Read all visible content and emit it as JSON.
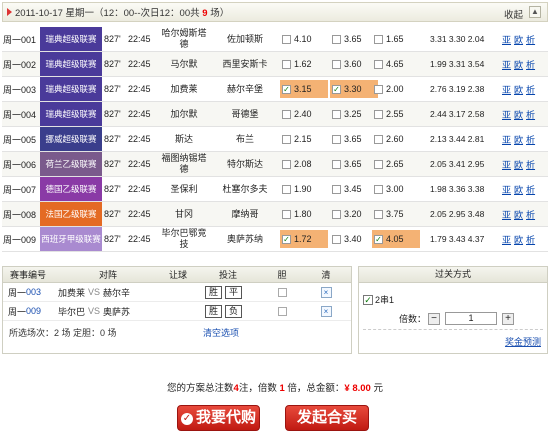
{
  "header": {
    "title_prefix": "2011-10-17 星期一（12：00--次日12：00共 ",
    "count": "9",
    "title_suffix": " 场）",
    "collapse": "收起",
    "up_icon": "▲"
  },
  "matches": [
    {
      "id": "周一001",
      "league": "瑞典超级联赛",
      "color": "#4a3a9a",
      "round": "827'",
      "time": "22:45",
      "home": "哈尔姆斯塔德",
      "away": "佐加顿斯",
      "odds": [
        "4.10",
        "3.65",
        "1.65"
      ],
      "sel": [
        false,
        false,
        false
      ],
      "avg": "3.31 3.30 2.04",
      "links": [
        "亚",
        "欧",
        "析"
      ]
    },
    {
      "id": "周一002",
      "league": "瑞典超级联赛",
      "color": "#4a3a9a",
      "round": "827'",
      "time": "22:45",
      "home": "马尔默",
      "away": "西里安斯卡",
      "odds": [
        "1.62",
        "3.60",
        "4.65"
      ],
      "sel": [
        false,
        false,
        false
      ],
      "avg": "1.99 3.31 3.54",
      "links": [
        "亚",
        "欧",
        "析"
      ]
    },
    {
      "id": "周一003",
      "league": "瑞典超级联赛",
      "color": "#4a3a9a",
      "round": "827'",
      "time": "22:45",
      "home": "加费莱",
      "away": "赫尔辛堡",
      "odds": [
        "3.15",
        "3.30",
        "2.00"
      ],
      "sel": [
        true,
        true,
        false
      ],
      "avg": "2.76 3.19 2.38",
      "links": [
        "亚",
        "欧",
        "析"
      ]
    },
    {
      "id": "周一004",
      "league": "瑞典超级联赛",
      "color": "#4a3a9a",
      "round": "827'",
      "time": "22:45",
      "home": "加尔默",
      "away": "哥德堡",
      "odds": [
        "2.40",
        "3.25",
        "2.55"
      ],
      "sel": [
        false,
        false,
        false
      ],
      "avg": "2.44 3.17 2.58",
      "links": [
        "亚",
        "欧",
        "析"
      ]
    },
    {
      "id": "周一005",
      "league": "挪威超级联赛",
      "color": "#3a3e8c",
      "round": "827'",
      "time": "22:45",
      "home": "斯达",
      "away": "布兰",
      "odds": [
        "2.15",
        "3.65",
        "2.60"
      ],
      "sel": [
        false,
        false,
        false
      ],
      "avg": "2.13 3.44 2.81",
      "links": [
        "亚",
        "欧",
        "析"
      ]
    },
    {
      "id": "周一006",
      "league": "荷兰乙级联赛",
      "color": "#7a5a8c",
      "round": "827'",
      "time": "22:45",
      "home": "福图纳锡塔德",
      "away": "特尔斯达",
      "odds": [
        "2.08",
        "3.65",
        "2.65"
      ],
      "sel": [
        false,
        false,
        false
      ],
      "avg": "2.05 3.41 2.95",
      "links": [
        "亚",
        "欧",
        "析"
      ]
    },
    {
      "id": "周一007",
      "league": "德国乙级联赛",
      "color": "#8a3aa6",
      "round": "827'",
      "time": "22:45",
      "home": "圣保利",
      "away": "杜塞尔多夫",
      "odds": [
        "1.90",
        "3.45",
        "3.00"
      ],
      "sel": [
        false,
        false,
        false
      ],
      "avg": "1.98 3.36 3.38",
      "links": [
        "亚",
        "欧",
        "析"
      ]
    },
    {
      "id": "周一008",
      "league": "法国乙级联赛",
      "color": "#e46a24",
      "round": "827'",
      "time": "22:45",
      "home": "甘冈",
      "away": "摩纳哥",
      "odds": [
        "1.80",
        "3.20",
        "3.75"
      ],
      "sel": [
        false,
        false,
        false
      ],
      "avg": "2.05 2.95 3.48",
      "links": [
        "亚",
        "欧",
        "析"
      ]
    },
    {
      "id": "周一009",
      "league": "西班牙甲级联赛",
      "color": "#a98ad0",
      "round": "827'",
      "time": "22:45",
      "home": "毕尔巴鄂竞技",
      "away": "奥萨苏纳",
      "odds": [
        "1.72",
        "3.40",
        "4.05"
      ],
      "sel": [
        true,
        false,
        true
      ],
      "avg": "1.79 3.43 4.37",
      "links": [
        "亚",
        "欧",
        "析"
      ]
    }
  ],
  "slip": {
    "headers": [
      "赛事编号",
      "对阵",
      "让球",
      "投注",
      "胆",
      "清"
    ],
    "rows": [
      {
        "id_prefix": "周一",
        "id_num": "003",
        "home": "加费莱",
        "vs": "VS",
        "away": "赫尔辛",
        "bets": [
          "胜",
          "平"
        ],
        "clear": "×"
      },
      {
        "id_prefix": "周一",
        "id_num": "009",
        "home": "毕尔巴",
        "vs": "VS",
        "away": "奥萨苏",
        "bets": [
          "胜",
          "负"
        ],
        "clear": "×"
      }
    ],
    "footer": "所选场次：2 场  定胆：0 场",
    "clear_all": "清空选项"
  },
  "pass": {
    "title": "过关方式",
    "option": "2串1",
    "mult_label": "倍数：",
    "minus": "−",
    "value": "1",
    "plus": "+",
    "predict": "奖金预测"
  },
  "summary": {
    "t1": "您的方案总注数",
    "bets": "4",
    "t2": "注，倍数 ",
    "mult": "1",
    "t3": " 倍，总金额：",
    "amount": "¥ 8.00",
    "t4": " 元"
  },
  "buttons": {
    "daigou": "我要代购",
    "hemai": "发起合买",
    "daigou_icon": "✓"
  }
}
